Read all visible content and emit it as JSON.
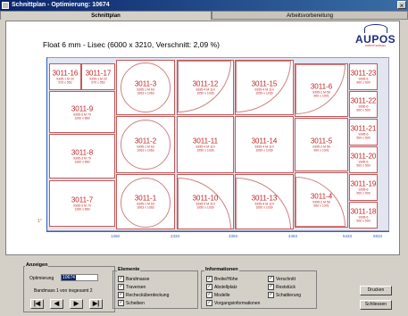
{
  "window": {
    "title": "Schnittplan - Optimierung: 10674",
    "close": "×"
  },
  "tabs": [
    {
      "label": "Schnittplan"
    },
    {
      "label": "Arbeitsvorbereitung"
    }
  ],
  "plan": {
    "title": "Float 6 mm - Lisec (6000 x 3210, Verschnitt: 2,09 %)"
  },
  "logo": {
    "text": "AUPOS",
    "tagline": "AUPOS Software"
  },
  "pieces": [
    {
      "id": "3011-16",
      "ref": "9395-1 M 20",
      "dim": "570 x 552"
    },
    {
      "id": "3011-17",
      "ref": "9395-1 M 20",
      "dim": "570 x 552"
    },
    {
      "id": "3011-9",
      "ref": "9395-3 M 79",
      "dim": "1260 x 860"
    },
    {
      "id": "3011-8",
      "ref": "9395-3 M 79",
      "dim": "1260 x 860"
    },
    {
      "id": "3011-7",
      "ref": "9395-3 M 79",
      "dim": "1260 x 860"
    },
    {
      "id": "3011-3",
      "ref": "9395-1 M 63",
      "dim": "1063 x 1063"
    },
    {
      "id": "3011-2",
      "ref": "9395-1 M 63",
      "dim": "1063 x 1063"
    },
    {
      "id": "3011-1",
      "ref": "9395-1 M 63",
      "dim": "1063 x 1063"
    },
    {
      "id": "3011-12",
      "ref": "9395-4 M 114",
      "dim": "1050 x 1039"
    },
    {
      "id": "3011-11",
      "ref": "9395-4 M 114",
      "dim": "1050 x 1039"
    },
    {
      "id": "3011-10",
      "ref": "9395-4 M 114",
      "dim": "1050 x 1039"
    },
    {
      "id": "3011-15",
      "ref": "9395-4 M 114",
      "dim": "1050 x 1039"
    },
    {
      "id": "3011-14",
      "ref": "9395-4 M 114",
      "dim": "1050 x 1039"
    },
    {
      "id": "3011-13",
      "ref": "9395-4 M 114",
      "dim": "1050 x 1039"
    },
    {
      "id": "3011-6",
      "ref": "9395-2 M 56",
      "dim": "900 x 1001"
    },
    {
      "id": "3011-5",
      "ref": "9395-2 M 56",
      "dim": "900 x 1001"
    },
    {
      "id": "3011-4",
      "ref": "9395-2 M 56",
      "dim": "900 x 1001"
    },
    {
      "id": "3011-23",
      "ref": "9395-6",
      "dim": "500 x 500"
    },
    {
      "id": "3011-22",
      "ref": "9395-6",
      "dim": "500 x 500"
    },
    {
      "id": "3011-21",
      "ref": "9395-6",
      "dim": "500 x 500"
    },
    {
      "id": "3011-20",
      "ref": "9395-6",
      "dim": "500 x 500"
    },
    {
      "id": "3011-19",
      "ref": "9395-6",
      "dim": "500 x 500"
    },
    {
      "id": "3011-18",
      "ref": "9395-6",
      "dim": "500 x 500"
    }
  ],
  "axis": {
    "ticks": [
      "1260",
      "2333",
      "3393",
      "4463",
      "5433",
      "5933"
    ],
    "angle": "1°"
  },
  "anzeigen": {
    "label": "Anzeigen",
    "optimierung_label": "Optimierung",
    "optimierung_value": "10674",
    "bandmass": "Bandmass 1 von insgesamt 2",
    "nav": [
      "|◀",
      "◀",
      "▶",
      "▶|"
    ]
  },
  "elemente": {
    "label": "Elemente",
    "items": [
      "Bandmasse",
      "Traversen",
      "Rechecküberdeckung",
      "Scheiben"
    ]
  },
  "informationen": {
    "label": "Informationen",
    "items": [
      "Breite/Höhe",
      "Abstellplatz",
      "Modelle",
      "Vorgangsinformationen",
      "Verschnitt",
      "Reststück",
      "Schattierung"
    ]
  },
  "buttons": {
    "drucken": "Drucken",
    "schliessen": "Schliessen"
  }
}
